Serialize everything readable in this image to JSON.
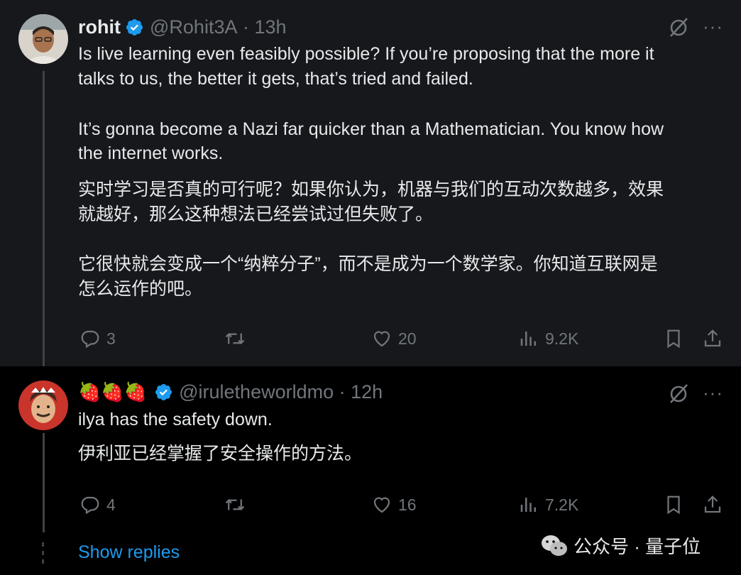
{
  "tweet1": {
    "name": "rohit",
    "handle": "@Rohit3A",
    "time": "13h",
    "text_en": [
      "Is live learning even feasibly possible? If you’re proposing that the more it",
      "talks to us, the better it gets, that’s tried and failed.",
      "It’s gonna become a Nazi far quicker than a Mathematician. You know how",
      "the internet works."
    ],
    "text_zh": [
      "实时学习是否真的可行呢？如果你认为，机器与我们的互动次数越多，效果",
      "就越好，那么这种想法已经尝试过但失败了。",
      "它很快就会变成一个“纳粹分子”，而不是成为一个数学家。你知道互联网是",
      "怎么运作的吧。"
    ],
    "replies": "3",
    "likes": "20",
    "views": "9.2K"
  },
  "tweet2": {
    "name_emoji": "🍓🍓🍓",
    "handle": "@iruletheworldmo",
    "time": "12h",
    "text_en": "ilya has the safety down.",
    "text_zh": "伊利亚已经掌握了安全操作的方法。",
    "replies": "4",
    "likes": "16",
    "views": "7.2K"
  },
  "show_replies": "Show replies",
  "watermark": "公众号 · 量子位",
  "colors": {
    "accent": "#1d9bf0",
    "muted": "#71767b",
    "text": "#e7e9ea",
    "bg_tweet1": "#16181c",
    "bg_tweet2": "#000000"
  },
  "icons": [
    "grok-icon",
    "more-icon",
    "reply-icon",
    "retweet-icon",
    "like-icon",
    "views-icon",
    "bookmark-icon",
    "share-icon",
    "verified-badge-icon",
    "wechat-icon"
  ]
}
